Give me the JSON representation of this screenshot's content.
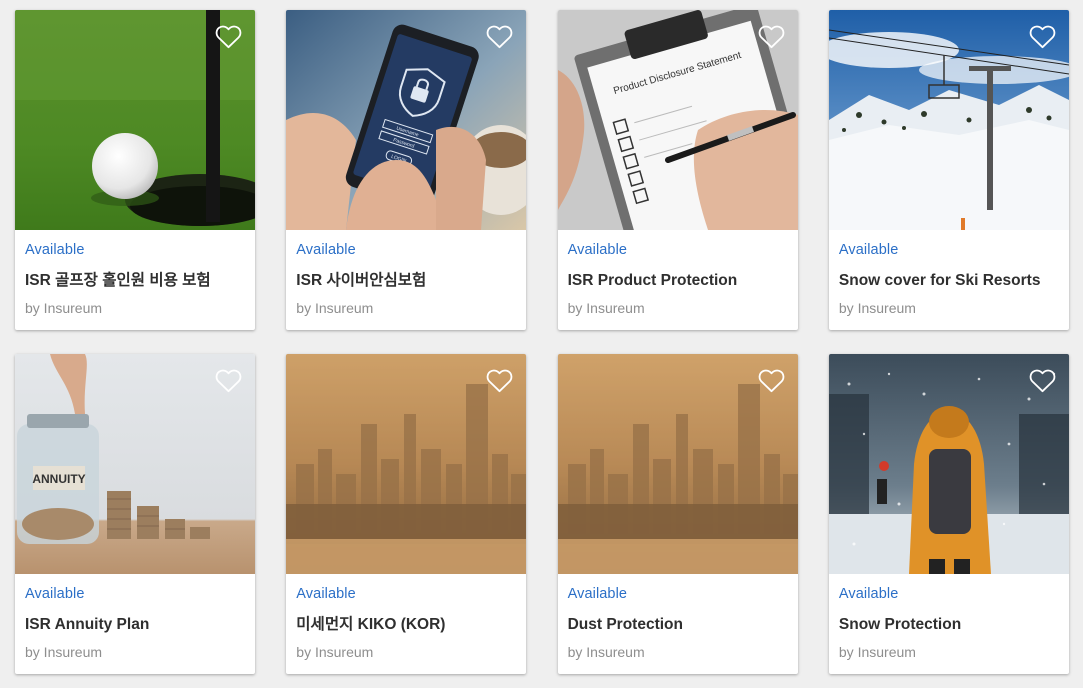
{
  "products": [
    {
      "status": "Available",
      "title": "ISR 골프장 홀인원 비용 보험",
      "provider": "by Insureum",
      "icon": "heart-outline-icon"
    },
    {
      "status": "Available",
      "title": "ISR 사이버안심보험",
      "provider": "by Insureum",
      "icon": "heart-outline-icon"
    },
    {
      "status": "Available",
      "title": "ISR Product Protection",
      "provider": "by Insureum",
      "icon": "heart-outline-icon"
    },
    {
      "status": "Available",
      "title": "Snow cover for Ski Resorts",
      "provider": "by Insureum",
      "icon": "heart-outline-icon"
    },
    {
      "status": "Available",
      "title": "ISR Annuity Plan",
      "provider": "by Insureum",
      "icon": "heart-outline-icon"
    },
    {
      "status": "Available",
      "title": "미세먼지 KIKO (KOR)",
      "provider": "by Insureum",
      "icon": "heart-outline-icon"
    },
    {
      "status": "Available",
      "title": "Dust Protection",
      "provider": "by Insureum",
      "icon": "heart-outline-icon"
    },
    {
      "status": "Available",
      "title": "Snow Protection",
      "provider": "by Insureum",
      "icon": "heart-outline-icon"
    }
  ],
  "image_text": {
    "phone_username": "Username",
    "phone_password": "Password",
    "phone_login": "LOGIN",
    "clipboard_heading": "Product Disclosure Statement",
    "jar_label": "ANNUITY"
  },
  "colors": {
    "accent": "#2b6fc7",
    "title": "#2f2f2f",
    "muted": "#8e8e8e"
  }
}
